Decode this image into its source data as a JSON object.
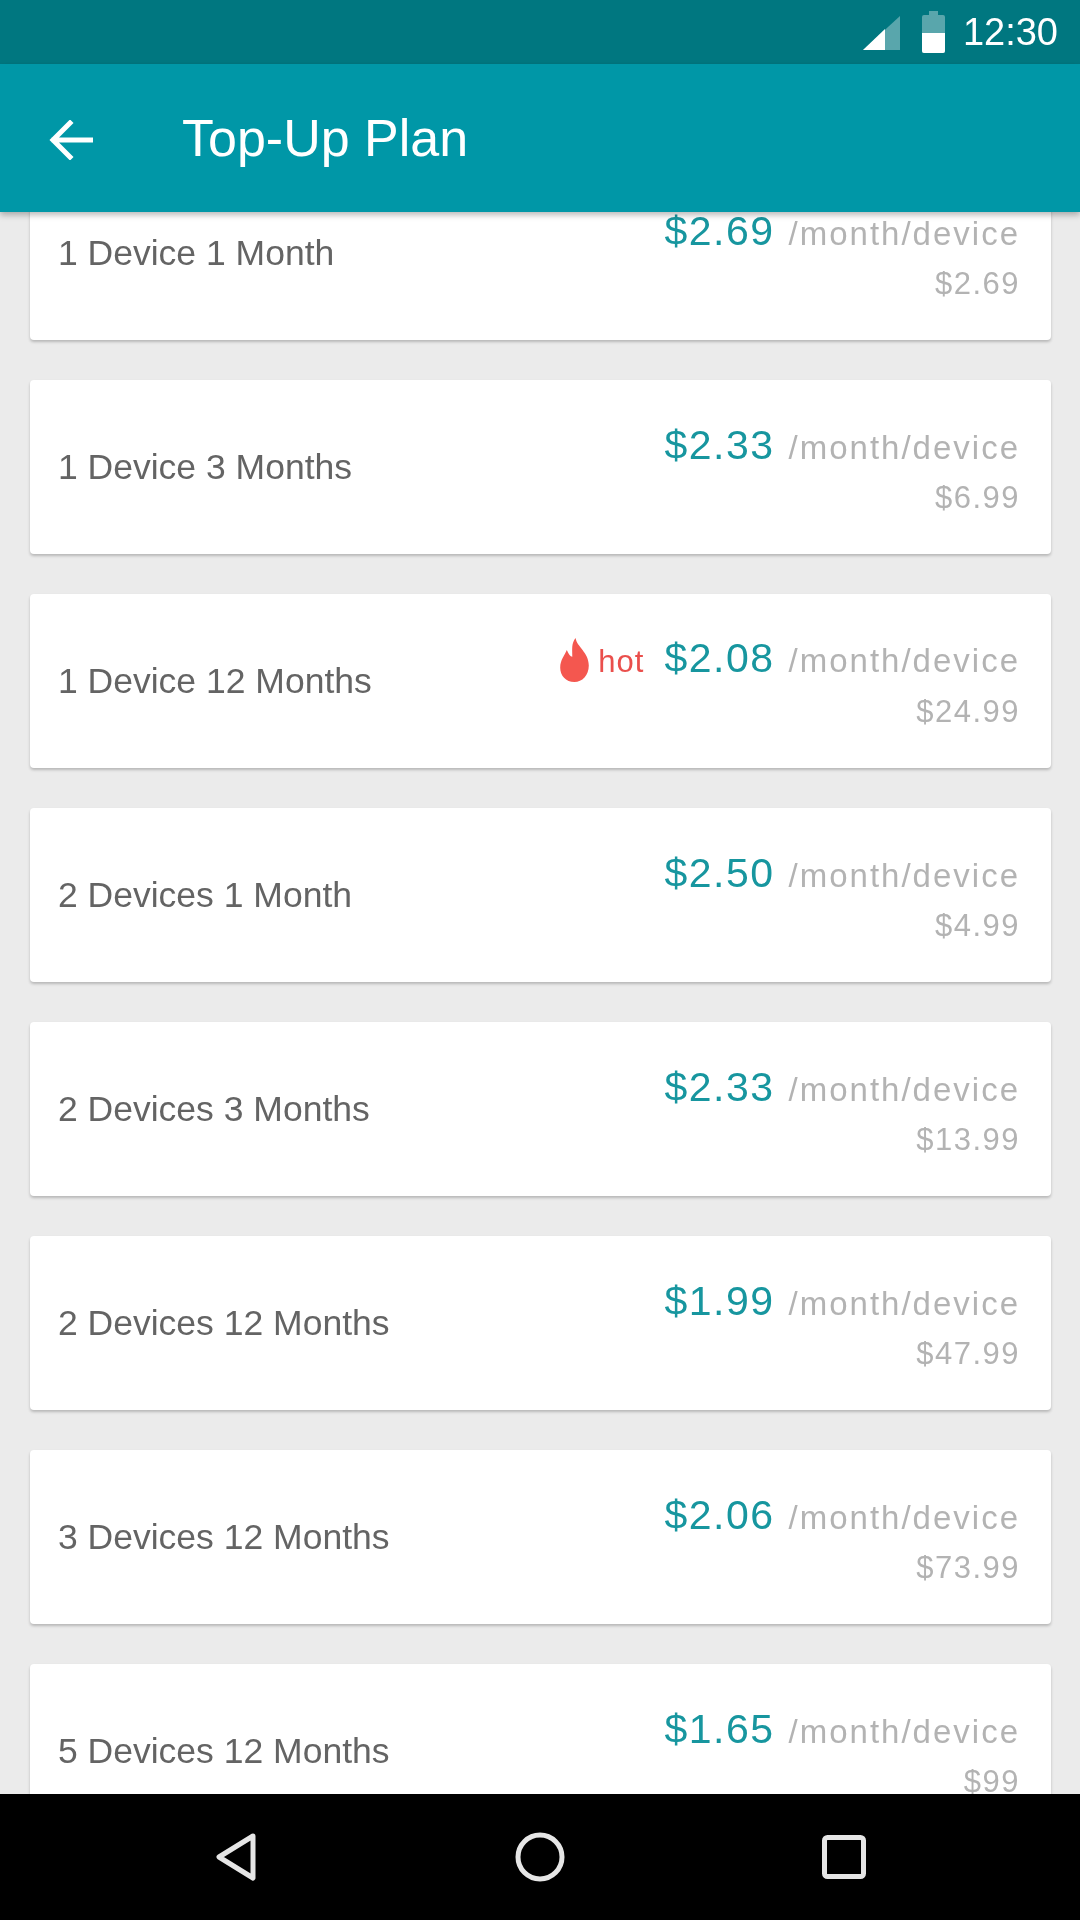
{
  "status_bar": {
    "time": "12:30"
  },
  "app_bar": {
    "title": "Top-Up Plan"
  },
  "plans": [
    {
      "name": "1 Device 1 Month",
      "price": "$2.69",
      "unit": "/month/device",
      "total": "$2.69"
    },
    {
      "name": "1 Device 3 Months",
      "price": "$2.33",
      "unit": "/month/device",
      "total": "$6.99"
    },
    {
      "name": "1 Device 12 Months",
      "badge": "hot",
      "price": "$2.08",
      "unit": "/month/device",
      "total": "$24.99"
    },
    {
      "name": "2 Devices 1 Month",
      "price": "$2.50",
      "unit": "/month/device",
      "total": "$4.99"
    },
    {
      "name": "2 Devices 3 Months",
      "price": "$2.33",
      "unit": "/month/device",
      "total": "$13.99"
    },
    {
      "name": "2 Devices 12 Months",
      "price": "$1.99",
      "unit": "/month/device",
      "total": "$47.99"
    },
    {
      "name": "3 Devices 12 Months",
      "price": "$2.06",
      "unit": "/month/device",
      "total": "$73.99"
    },
    {
      "name": "5 Devices 12 Months",
      "price": "$1.65",
      "unit": "/month/device",
      "total": "$99"
    }
  ]
}
